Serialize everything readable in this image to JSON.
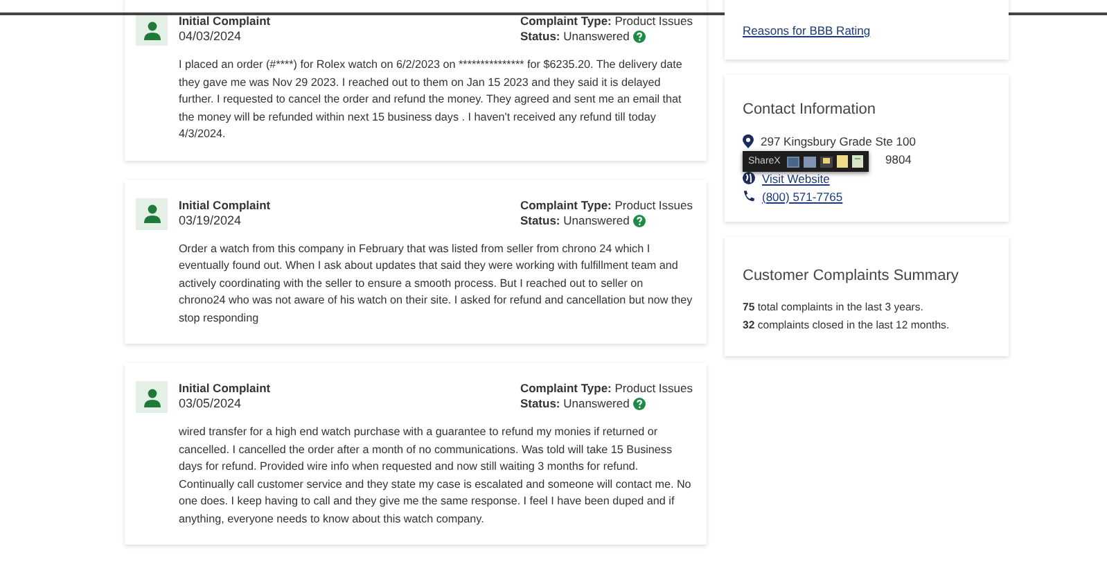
{
  "complaints": [
    {
      "title": "Initial Complaint",
      "date": "04/03/2024",
      "type_label": "Complaint Type:",
      "type_value": "Product Issues",
      "status_label": "Status:",
      "status_value": "Unanswered",
      "body": "I placed an order (#****) for Rolex watch on 6/2/2023 on *************** for $6235.20. The delivery date they gave me was Nov 29 2023. I reached out to them on Jan 15 2023 and they said it is delayed further. I requested to cancel the order and refund the money. They agreed and sent me an email that the money will be refunded within next 15 business days . I haven't received any refund till today 4/3/2024."
    },
    {
      "title": "Initial Complaint",
      "date": "03/19/2024",
      "type_label": "Complaint Type:",
      "type_value": "Product Issues",
      "status_label": "Status:",
      "status_value": "Unanswered",
      "body": "Order a watch from this company in February that was listed from seller from chrono 24 which I eventually found out. When I ask about updates that said they were working with fulfillment team and actively coordinating with the seller to ensure a smooth process. But I reached out to seller on chrono24 who was not aware of his watch on their site. I asked for refund and cancellation but now they stop responding"
    },
    {
      "title": "Initial Complaint",
      "date": "03/05/2024",
      "type_label": "Complaint Type:",
      "type_value": "Product Issues",
      "status_label": "Status:",
      "status_value": "Unanswered",
      "body": "wired transfer for a high end watch purchase with a guarantee to refund my monies if returned or cancelled. I cancelled the order after a month of no communications. Was told will take 15 Business days for refund. Provided wire info when requested and now still waiting 3 months for refund. Continually call customer service and they state my case is escalated and someone will contact me. No one does. I keep having to call and they give me the same response. I feel I have been duped and if anything, everyone needs to know about this watch company."
    }
  ],
  "rating_link": "Reasons for BBB Rating",
  "contact": {
    "title": "Contact Information",
    "address_line1": "297 Kingsbury Grade Ste 100",
    "address_line2": "9804",
    "website": "Visit Website",
    "phone": "(800) 571-7765"
  },
  "sharex": {
    "label": "ShareX"
  },
  "summary": {
    "title": "Customer Complaints Summary",
    "lines": [
      "**75** total complaints in the last 3 years.",
      "**32** complaints closed in the last 12 months."
    ]
  }
}
